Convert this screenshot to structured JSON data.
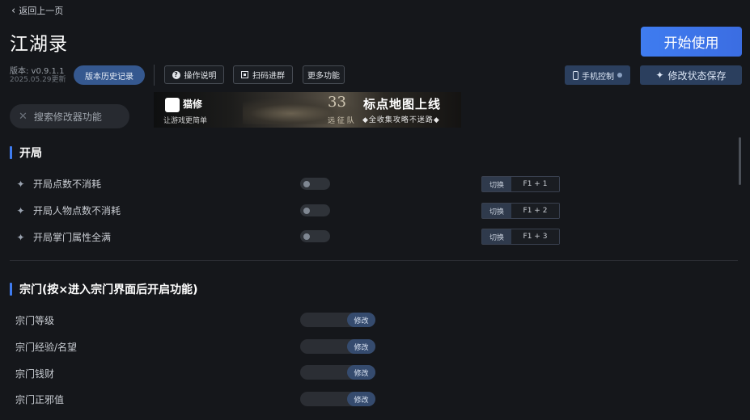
{
  "nav": {
    "back_label": "返回上一页"
  },
  "app": {
    "title": "江湖录",
    "version": "版本: v0.9.1.1",
    "updated": "2025.05.29更新"
  },
  "toolbar": {
    "history": "版本历史记录",
    "guide": "操作说明",
    "qr_group": "扫码进群",
    "more": "更多功能",
    "phone_control": "手机控制",
    "save_state": "修改状态保存",
    "start": "开始使用"
  },
  "search": {
    "placeholder": "搜索修改器功能"
  },
  "banner": {
    "brand": "猫修",
    "slogan": "让游戏更简单",
    "number": "33",
    "team": "远 征 队",
    "headline": "标点地图上线",
    "tagline": "◆全收集攻略不迷路◆"
  },
  "sections": [
    {
      "title": "开局",
      "rows": [
        {
          "label": "开局点数不消耗",
          "switch_label": "切换",
          "hotkey": "F1 + 1",
          "enabled": false
        },
        {
          "label": "开局人物点数不消耗",
          "switch_label": "切换",
          "hotkey": "F1 + 2",
          "enabled": false
        },
        {
          "label": "开局掌门属性全满",
          "switch_label": "切换",
          "hotkey": "F1 + 3",
          "enabled": false
        }
      ]
    },
    {
      "title": "宗门(按×进入宗门界面后开启功能)",
      "rows": [
        {
          "label": "宗门等级",
          "action": "修改"
        },
        {
          "label": "宗门经验/名望",
          "action": "修改"
        },
        {
          "label": "宗门钱财",
          "action": "修改"
        },
        {
          "label": "宗门正邪值",
          "action": "修改"
        }
      ]
    }
  ],
  "colors": {
    "accent": "#3f7cf0",
    "background": "#15171b"
  }
}
